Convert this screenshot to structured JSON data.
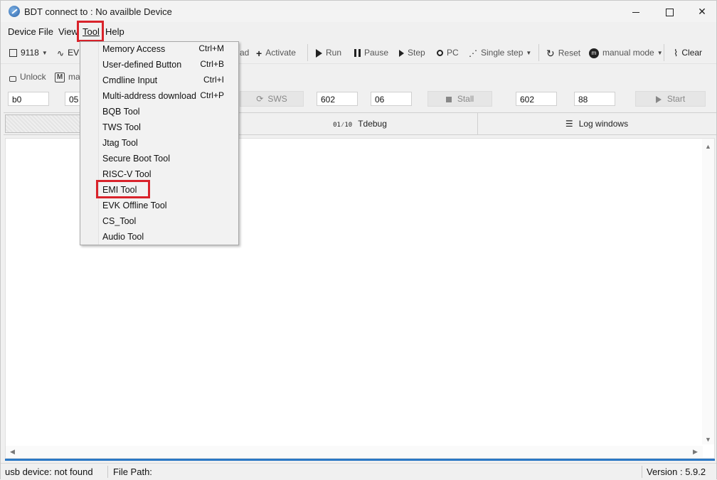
{
  "window": {
    "title": "BDT connect to : No availble Device",
    "minimize_glyph": "",
    "close_glyph": "✕"
  },
  "menubar": {
    "items": [
      "Device",
      "File",
      "View",
      "Tool",
      "Help"
    ]
  },
  "toolbar1": {
    "chip_label": "9118",
    "evk_label": "EV",
    "download_partial": "ad",
    "activate_label": "Activate",
    "run_label": "Run",
    "pause_label": "Pause",
    "step_label": "Step",
    "pc_label": "PC",
    "single_step_label": "Single step",
    "reset_label": "Reset",
    "mode_label": "manual mode",
    "clear_label": "Clear"
  },
  "toolbar2": {
    "unlock_label": "Unlock",
    "m_partial": "ma"
  },
  "toolbar3": {
    "field1": "b0",
    "field2": "05",
    "sws_label": "SWS",
    "field3": "602",
    "field4": "06",
    "stall_label": "Stall",
    "field5": "602",
    "field6": "88",
    "start_label": "Start"
  },
  "tabs": {
    "tdebug_label": "Tdebug",
    "log_label": "Log windows"
  },
  "statusbar": {
    "usb_status": "usb device: not found",
    "file_path_label": "File Path:",
    "version": "Version : 5.9.2"
  },
  "tool_menu": {
    "items": [
      {
        "label": "Memory Access",
        "shortcut": "Ctrl+M"
      },
      {
        "label": "User-defined Button",
        "shortcut": "Ctrl+B"
      },
      {
        "label": "Cmdline Input",
        "shortcut": "Ctrl+I"
      },
      {
        "label": "Multi-address download",
        "shortcut": "Ctrl+P"
      },
      {
        "label": "BQB Tool",
        "shortcut": ""
      },
      {
        "label": "TWS Tool",
        "shortcut": ""
      },
      {
        "label": "Jtag Tool",
        "shortcut": ""
      },
      {
        "label": "Secure Boot Tool",
        "shortcut": ""
      },
      {
        "label": "RISC-V Tool",
        "shortcut": ""
      },
      {
        "label": "EMI Tool",
        "shortcut": ""
      },
      {
        "label": "EVK Offline Tool",
        "shortcut": ""
      },
      {
        "label": "CS_Tool",
        "shortcut": ""
      },
      {
        "label": "Audio Tool",
        "shortcut": ""
      }
    ]
  },
  "colors": {
    "highlight": "#d9232b",
    "accent_bar": "#2b78c5"
  }
}
